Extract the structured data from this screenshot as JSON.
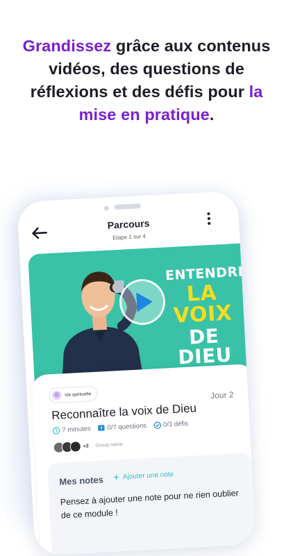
{
  "headline": {
    "part1": "Grandissez",
    "part2": " grâce aux contenus vidéos, des questions de réflexions et des défis pour ",
    "part3": "la mise en pratique",
    "part4": "."
  },
  "colors": {
    "highlight": "#7b1fd0",
    "video_bg": "#39c2a8",
    "play": "#1e86e0",
    "accent": "#2bbfd0"
  },
  "topbar": {
    "back_icon": "arrow-left-icon",
    "title": "Parcours",
    "subtitle": "Etape 1 sur 4",
    "more_icon": "more-vertical-icon"
  },
  "video": {
    "title_line1": "ENTENDRE",
    "title_line2": "LA VOIX",
    "title_line3": "DE DIEU",
    "play_icon": "play-icon"
  },
  "module": {
    "category": "Vie spirituelle",
    "day": "Jour 2",
    "title": "Reconnaître la voix de Dieu",
    "duration": "7 minutes",
    "questions": "0/7 questions",
    "challenges": "0/3 défis",
    "members_more": "+2",
    "group_name": "Group name"
  },
  "notes": {
    "title": "Mes notes",
    "add_label": "Ajouter une note",
    "placeholder": "Pensez à ajouter une note pour ne rien oublier de ce module !"
  }
}
